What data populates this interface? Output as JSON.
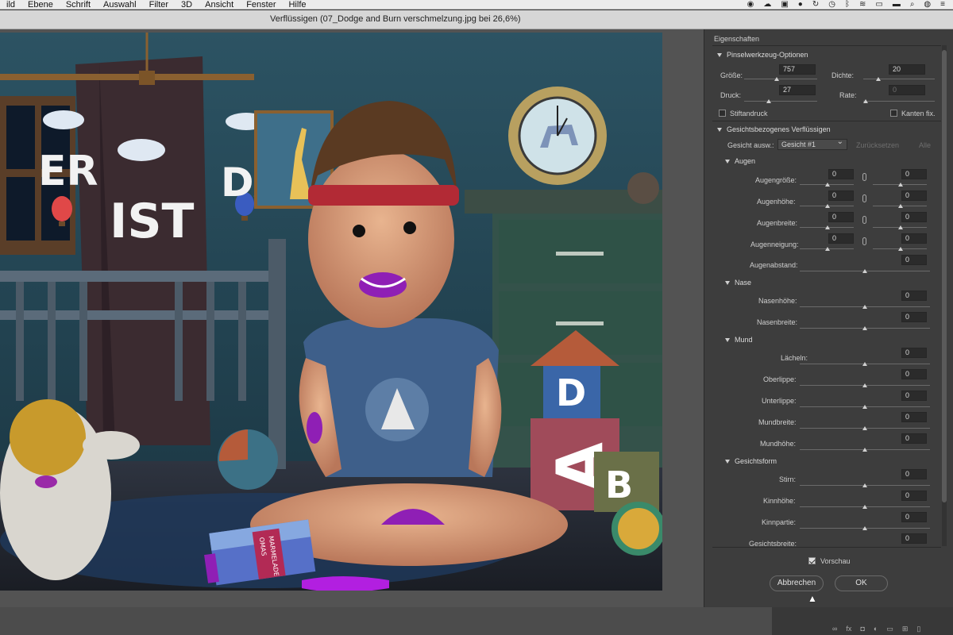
{
  "menubar": {
    "items": [
      "ild",
      "Ebene",
      "Schrift",
      "Auswahl",
      "Filter",
      "3D",
      "Ansicht",
      "Fenster",
      "Hilfe"
    ]
  },
  "window": {
    "title": "Verflüssigen (07_Dodge and Burn verschmelzung.jpg bei 26,6%)"
  },
  "canvas": {
    "letters_er": "ER",
    "letters_ist": "IST",
    "letters_da": "DA",
    "block_d": "D",
    "block_a": "A",
    "block_b": "B",
    "jar_label_1": "OMAS",
    "jar_label_2": "MARMELADE"
  },
  "panel": {
    "title": "Eigenschaften",
    "brush": {
      "header": "Pinselwerkzeug-Optionen",
      "size_label": "Größe:",
      "size_value": "757",
      "density_label": "Dichte:",
      "density_value": "20",
      "pressure_label": "Druck:",
      "pressure_value": "27",
      "rate_label": "Rate:",
      "rate_value": "0",
      "stylus_label": "Stiftandruck",
      "pin_edges_label": "Kanten fix."
    },
    "face": {
      "header": "Gesichtsbezogenes Verflüssigen",
      "select_label": "Gesicht ausw.:",
      "select_value": "Gesicht #1",
      "reset_label": "Zurücksetzen",
      "all_label": "Alle"
    },
    "eyes": {
      "header": "Augen",
      "rows": [
        {
          "label": "Augengröße:",
          "left": "0",
          "right": "0"
        },
        {
          "label": "Augenhöhe:",
          "left": "0",
          "right": "0"
        },
        {
          "label": "Augenbreite:",
          "left": "0",
          "right": "0"
        },
        {
          "label": "Augenneigung:",
          "left": "0",
          "right": "0"
        }
      ],
      "distance_label": "Augenabstand:",
      "distance_value": "0"
    },
    "nose": {
      "header": "Nase",
      "rows": [
        {
          "label": "Nasenhöhe:",
          "value": "0"
        },
        {
          "label": "Nasenbreite:",
          "value": "0"
        }
      ]
    },
    "mouth": {
      "header": "Mund",
      "rows": [
        {
          "label": "Lächeln:",
          "value": "0"
        },
        {
          "label": "Oberlippe:",
          "value": "0"
        },
        {
          "label": "Unterlippe:",
          "value": "0"
        },
        {
          "label": "Mundbreite:",
          "value": "0"
        },
        {
          "label": "Mundhöhe:",
          "value": "0"
        }
      ]
    },
    "faceshape": {
      "header": "Gesichtsform",
      "rows": [
        {
          "label": "Stirn:",
          "value": "0"
        },
        {
          "label": "Kinnhöhe:",
          "value": "0"
        },
        {
          "label": "Kinnpartie:",
          "value": "0"
        },
        {
          "label": "Gesichtsbreite:",
          "value": "0"
        }
      ]
    },
    "preview_label": "Vorschau",
    "cancel_label": "Abbrechen",
    "ok_label": "OK"
  },
  "bottombar": {
    "fx_label": "fx"
  }
}
